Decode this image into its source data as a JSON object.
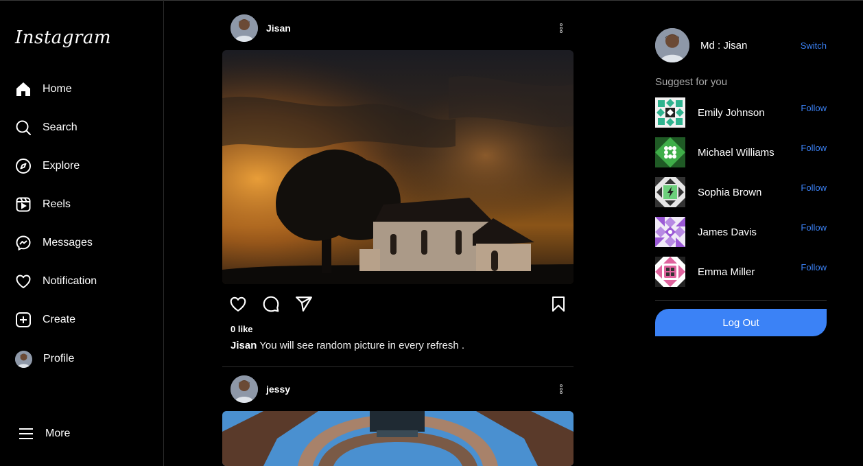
{
  "app": {
    "logo": "Instagram"
  },
  "nav": {
    "items": [
      {
        "label": "Home",
        "icon": "home-icon"
      },
      {
        "label": "Search",
        "icon": "search-icon"
      },
      {
        "label": "Explore",
        "icon": "compass-icon"
      },
      {
        "label": "Reels",
        "icon": "reels-icon"
      },
      {
        "label": "Messages",
        "icon": "messenger-icon"
      },
      {
        "label": "Notification",
        "icon": "heart-icon"
      },
      {
        "label": "Create",
        "icon": "plus-square-icon"
      },
      {
        "label": "Profile",
        "icon": "avatar"
      }
    ],
    "more": {
      "label": "More",
      "icon": "hamburger-icon"
    }
  },
  "posts": [
    {
      "username": "Jisan",
      "likes": "0 like",
      "caption_user": "Jisan",
      "caption_text": " You will see random picture in every refresh ."
    },
    {
      "username": "jessy"
    }
  ],
  "account": {
    "name": "Md : Jisan",
    "switch_label": "Switch"
  },
  "suggestions": {
    "title": "Suggest for you",
    "follow_label": "Follow",
    "users": [
      {
        "name": "Emily Johnson",
        "color": "#2fb38f"
      },
      {
        "name": "Michael Williams",
        "color": "#3fae49"
      },
      {
        "name": "Sophia Brown",
        "color": "#6ccf7b"
      },
      {
        "name": "James Davis",
        "color": "#9b59d6"
      },
      {
        "name": "Emma Miller",
        "color": "#e0649e"
      }
    ]
  },
  "logout_label": "Log Out",
  "colors": {
    "accent": "#3b82f6",
    "background": "#000000"
  }
}
